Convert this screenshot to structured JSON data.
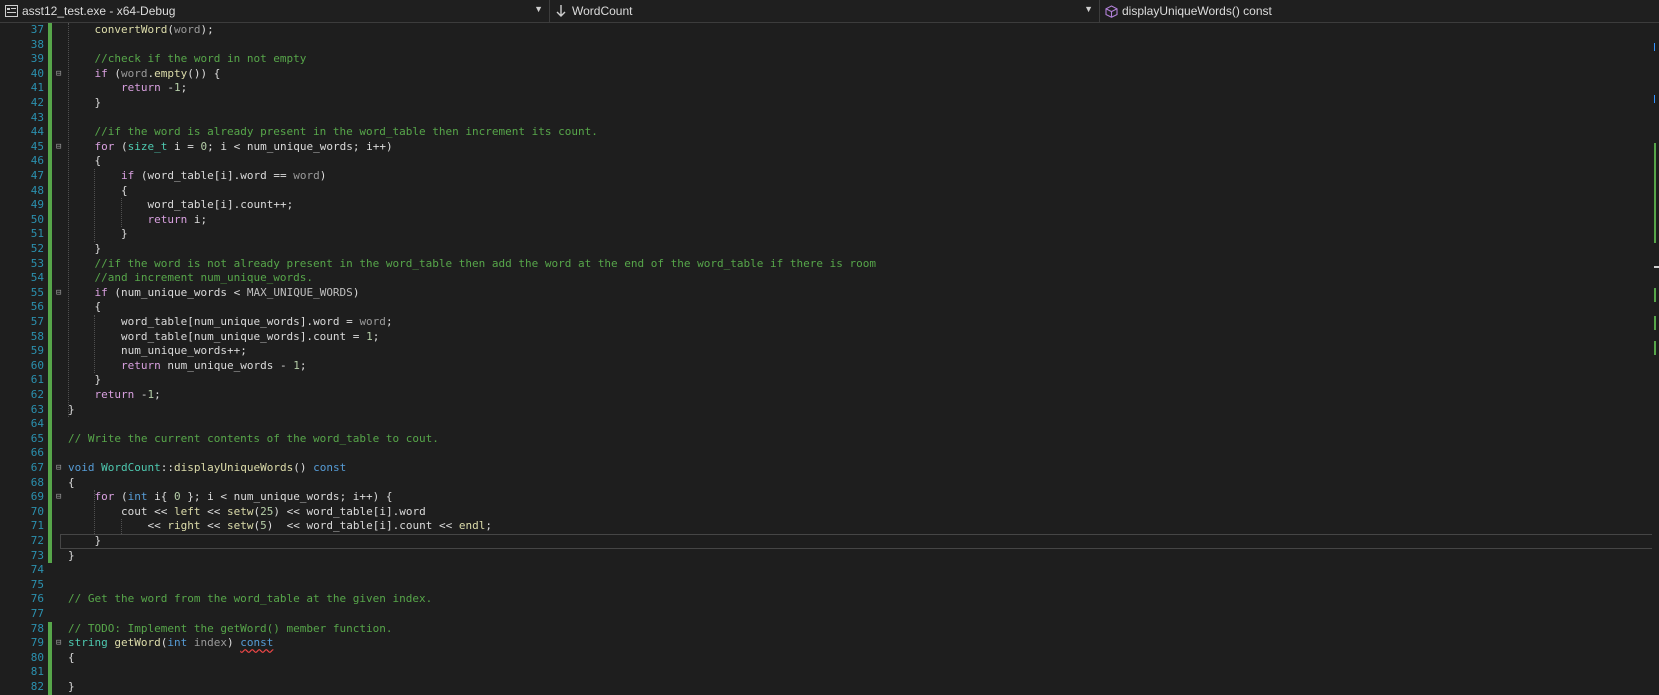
{
  "navbar": {
    "project": "asst12_test.exe - x64-Debug",
    "scope": "WordCount",
    "member": "displayUniqueWords() const"
  },
  "icons": {
    "project": "project-icon",
    "scope": "class-scope-icon",
    "member": "method-cube-icon",
    "dropdown": "chevron-down-icon"
  },
  "colors": {
    "background": "#1e1e1e",
    "line_number": "#2b91af",
    "keyword": "#569cd6",
    "control_keyword": "#d8a0df",
    "type": "#4ec9b0",
    "function": "#dcdcaa",
    "comment": "#57a64a",
    "number": "#b5cea8"
  },
  "editor": {
    "current_line": 72,
    "lines": [
      {
        "n": "37",
        "tokens": [
          [
            "f",
            "convertWord"
          ],
          [
            "",
            "("
          ],
          [
            "p",
            "word"
          ],
          [
            "",
            ");"
          ]
        ]
      },
      {
        "n": "38",
        "tokens": []
      },
      {
        "n": "39",
        "tokens": [
          [
            "cm",
            "//check if the word in not empty"
          ]
        ]
      },
      {
        "n": "40",
        "tokens": [
          [
            "c",
            "if"
          ],
          [
            "",
            " ("
          ],
          [
            "p",
            "word"
          ],
          [
            "",
            "."
          ],
          [
            "f",
            "empty"
          ],
          [
            "",
            "()) {"
          ]
        ]
      },
      {
        "n": "41",
        "tokens": [
          [
            "c",
            "    return"
          ],
          [
            "",
            " -"
          ],
          [
            "n",
            "1"
          ],
          [
            "",
            ";"
          ]
        ]
      },
      {
        "n": "42",
        "tokens": [
          [
            "",
            "}"
          ]
        ]
      },
      {
        "n": "43",
        "tokens": []
      },
      {
        "n": "44",
        "tokens": [
          [
            "cm",
            "//if the word is already present in the word_table then increment its count."
          ]
        ]
      },
      {
        "n": "45",
        "tokens": [
          [
            "c",
            "for"
          ],
          [
            "",
            " ("
          ],
          [
            "t",
            "size_t"
          ],
          [
            "",
            " i = "
          ],
          [
            "n",
            "0"
          ],
          [
            "",
            "; i < "
          ],
          [
            "m",
            "num_unique_words"
          ],
          [
            "",
            "; i++)"
          ]
        ]
      },
      {
        "n": "46",
        "tokens": [
          [
            "",
            "{"
          ]
        ]
      },
      {
        "n": "47",
        "tokens": [
          [
            "c",
            "    if"
          ],
          [
            "",
            " ("
          ],
          [
            "m",
            "word_table"
          ],
          [
            "",
            "[i]."
          ],
          [
            "m",
            "word"
          ],
          [
            "",
            " == "
          ],
          [
            "p",
            "word"
          ],
          [
            "",
            ")"
          ]
        ]
      },
      {
        "n": "48",
        "tokens": [
          [
            "",
            "    {"
          ]
        ]
      },
      {
        "n": "49",
        "tokens": [
          [
            "m",
            "        word_table"
          ],
          [
            "",
            "[i]."
          ],
          [
            "m",
            "count"
          ],
          [
            "",
            "++;"
          ]
        ]
      },
      {
        "n": "50",
        "tokens": [
          [
            "c",
            "        return"
          ],
          [
            "",
            " i;"
          ]
        ]
      },
      {
        "n": "51",
        "tokens": [
          [
            "",
            "    }"
          ]
        ]
      },
      {
        "n": "52",
        "tokens": [
          [
            "",
            "}"
          ]
        ]
      },
      {
        "n": "53",
        "tokens": [
          [
            "cm",
            "//if the word is not already present in the word_table then add the word at the end of the word_table if there is room"
          ]
        ]
      },
      {
        "n": "54",
        "tokens": [
          [
            "cm",
            "//and increment num_unique_words."
          ]
        ]
      },
      {
        "n": "55",
        "tokens": [
          [
            "c",
            "if"
          ],
          [
            "",
            " ("
          ],
          [
            "m",
            "num_unique_words"
          ],
          [
            "",
            " < "
          ],
          [
            "mac",
            "MAX_UNIQUE_WORDS"
          ],
          [
            "",
            ")"
          ]
        ]
      },
      {
        "n": "56",
        "tokens": [
          [
            "",
            "{"
          ]
        ]
      },
      {
        "n": "57",
        "tokens": [
          [
            "m",
            "    word_table"
          ],
          [
            "",
            "["
          ],
          [
            "m",
            "num_unique_words"
          ],
          [
            "",
            "]."
          ],
          [
            "m",
            "word"
          ],
          [
            "",
            " = "
          ],
          [
            "p",
            "word"
          ],
          [
            "",
            ";"
          ]
        ]
      },
      {
        "n": "58",
        "tokens": [
          [
            "m",
            "    word_table"
          ],
          [
            "",
            "["
          ],
          [
            "m",
            "num_unique_words"
          ],
          [
            "",
            "]."
          ],
          [
            "m",
            "count"
          ],
          [
            "",
            " = "
          ],
          [
            "n",
            "1"
          ],
          [
            "",
            ";"
          ]
        ]
      },
      {
        "n": "59",
        "tokens": [
          [
            "m",
            "    num_unique_words"
          ],
          [
            "",
            "++;"
          ]
        ]
      },
      {
        "n": "60",
        "tokens": [
          [
            "c",
            "    return"
          ],
          [
            "",
            " "
          ],
          [
            "m",
            "num_unique_words"
          ],
          [
            "",
            " - "
          ],
          [
            "n",
            "1"
          ],
          [
            "",
            ";"
          ]
        ]
      },
      {
        "n": "61",
        "tokens": [
          [
            "",
            "}"
          ]
        ]
      },
      {
        "n": "62",
        "tokens": [
          [
            "c",
            "return"
          ],
          [
            "",
            " -"
          ],
          [
            "n",
            "1"
          ],
          [
            "",
            ";"
          ]
        ]
      },
      {
        "n": "63",
        "tokens": [
          [
            "",
            "}"
          ]
        ]
      },
      {
        "n": "64",
        "tokens": []
      },
      {
        "n": "65",
        "tokens": [
          [
            "cm",
            "// Write the current contents of the word_table to cout."
          ]
        ]
      },
      {
        "n": "66",
        "tokens": []
      },
      {
        "n": "67",
        "tokens": [
          [
            "k",
            "void"
          ],
          [
            "",
            " "
          ],
          [
            "t",
            "WordCount"
          ],
          [
            "",
            "::"
          ],
          [
            "f",
            "displayUniqueWords"
          ],
          [
            "",
            "() "
          ],
          [
            "k",
            "const"
          ]
        ]
      },
      {
        "n": "68",
        "tokens": [
          [
            "",
            "{"
          ]
        ]
      },
      {
        "n": "69",
        "tokens": [
          [
            "c",
            "    for"
          ],
          [
            "",
            " ("
          ],
          [
            "k",
            "int"
          ],
          [
            "",
            " i{ "
          ],
          [
            "n",
            "0"
          ],
          [
            "",
            " }; i < "
          ],
          [
            "m",
            "num_unique_words"
          ],
          [
            "",
            "; i++) {"
          ]
        ]
      },
      {
        "n": "70",
        "tokens": [
          [
            "m",
            "        cout"
          ],
          [
            "",
            " << "
          ],
          [
            "f",
            "left"
          ],
          [
            "",
            " << "
          ],
          [
            "f",
            "setw"
          ],
          [
            "",
            "("
          ],
          [
            "n",
            "25"
          ],
          [
            "",
            ") << "
          ],
          [
            "m",
            "word_table"
          ],
          [
            "",
            "[i]."
          ],
          [
            "m",
            "word"
          ]
        ]
      },
      {
        "n": "71",
        "tokens": [
          [
            "",
            "            << "
          ],
          [
            "f",
            "right"
          ],
          [
            "",
            " << "
          ],
          [
            "f",
            "setw"
          ],
          [
            "",
            "("
          ],
          [
            "n",
            "5"
          ],
          [
            "",
            ")  << "
          ],
          [
            "m",
            "word_table"
          ],
          [
            "",
            "[i]."
          ],
          [
            "m",
            "count"
          ],
          [
            "",
            " << "
          ],
          [
            "f",
            "endl"
          ],
          [
            "",
            ";"
          ]
        ]
      },
      {
        "n": "72",
        "tokens": [
          [
            "",
            "    }"
          ]
        ]
      },
      {
        "n": "73",
        "tokens": [
          [
            "",
            "}"
          ]
        ]
      },
      {
        "n": "74",
        "tokens": []
      },
      {
        "n": "75",
        "tokens": []
      },
      {
        "n": "76",
        "tokens": [
          [
            "cm",
            "// Get the word from the word_table at the given index."
          ]
        ]
      },
      {
        "n": "77",
        "tokens": []
      },
      {
        "n": "78",
        "tokens": [
          [
            "cm",
            "// TODO: Implement the getWord() member function."
          ]
        ]
      },
      {
        "n": "79",
        "tokens": [
          [
            "t",
            "string"
          ],
          [
            "",
            " "
          ],
          [
            "f",
            "getWord"
          ],
          [
            "",
            "("
          ],
          [
            "k",
            "int"
          ],
          [
            "",
            " "
          ],
          [
            "p",
            "index"
          ],
          [
            "",
            ") "
          ],
          [
            "ksq",
            "const"
          ]
        ]
      },
      {
        "n": "80",
        "tokens": [
          [
            "",
            "{"
          ]
        ]
      },
      {
        "n": "81",
        "tokens": []
      },
      {
        "n": "82",
        "tokens": [
          [
            "",
            "}"
          ]
        ]
      }
    ]
  }
}
